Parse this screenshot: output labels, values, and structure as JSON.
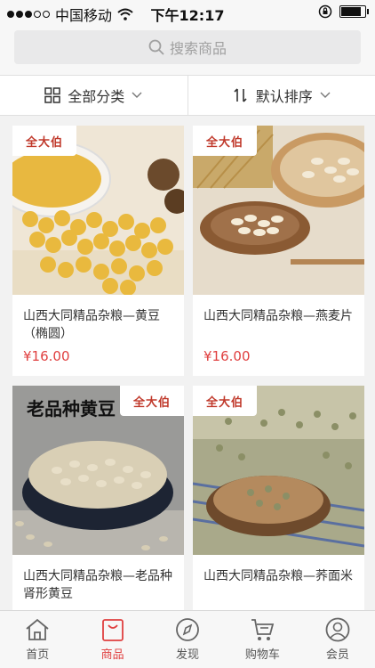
{
  "status_bar": {
    "carrier": "中国移动",
    "time": "下午12:17",
    "battery_level": 0.8
  },
  "search": {
    "placeholder": "搜索商品"
  },
  "filters": {
    "category": "全部分类",
    "sort": "默认排序"
  },
  "brand_logo_text": "全大伯",
  "products": [
    {
      "name": "山西大同精品杂粮—黄豆（椭圆）",
      "price": "¥16.00",
      "image": "soybeans-in-bowl"
    },
    {
      "name": "山西大同精品杂粮—燕麦片",
      "price": "¥16.00",
      "image": "oat-flakes-on-wood"
    },
    {
      "name": "山西大同精品杂粮—老品种肾形黄豆",
      "price": "",
      "image": "kidney-soybeans-bowl",
      "overlay_text": "老品种黄豆"
    },
    {
      "name": "山西大同精品杂粮—荞面米",
      "price": "",
      "image": "buckwheat-on-wood"
    }
  ],
  "tabbar": [
    {
      "label": "首页",
      "icon": "home-icon",
      "active": false
    },
    {
      "label": "商品",
      "icon": "bag-icon",
      "active": true
    },
    {
      "label": "发现",
      "icon": "compass-icon",
      "active": false
    },
    {
      "label": "购物车",
      "icon": "cart-icon",
      "active": false
    },
    {
      "label": "会员",
      "icon": "user-icon",
      "active": false
    }
  ],
  "colors": {
    "accent": "#e04040",
    "background": "#f2f2f2"
  }
}
